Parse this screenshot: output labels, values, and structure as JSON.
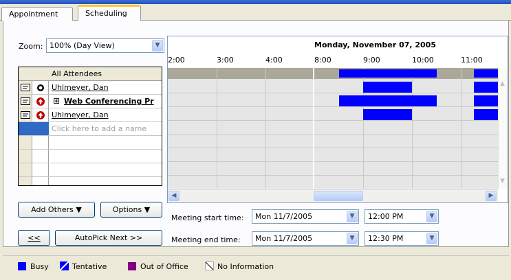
{
  "tabs": [
    {
      "label": "Appointment",
      "active": false
    },
    {
      "label": "Scheduling",
      "active": true
    }
  ],
  "zoom": {
    "label": "Zoom:",
    "value": "100% (Day View)"
  },
  "date_header": "Monday, November 07, 2005",
  "time_ticks": [
    "2:00",
    "3:00",
    "4:00",
    "8:00",
    "9:00",
    "10:00",
    "11:00"
  ],
  "attendees": {
    "header": "All Attendees",
    "rows": [
      {
        "name": "Uhlmeyer, Dan",
        "bold": false,
        "type_icon": "circle-black-icon"
      },
      {
        "name": "Web Conferencing Pr",
        "bold": true,
        "type_icon": "arrow-up-red-icon",
        "expand": "⊞"
      },
      {
        "name": "Uhlmeyer, Dan",
        "bold": false,
        "type_icon": "arrow-up-red-icon"
      }
    ],
    "add_placeholder": "Click here to add a name"
  },
  "buttons": {
    "add_others": "Add Others",
    "options": "Options",
    "prev": "<<",
    "autopick": "AutoPick Next >>"
  },
  "meeting": {
    "start_label": "Meeting start time:",
    "start_date": "Mon 11/7/2005",
    "start_time": "12:00 PM",
    "end_label": "Meeting end time:",
    "end_date": "Mon 11/7/2005",
    "end_time": "12:30 PM"
  },
  "legend": [
    {
      "label": "Busy",
      "color": "#0000ff"
    },
    {
      "label": "Tentative",
      "color": "#0000ff"
    },
    {
      "label": "Out of Office",
      "color": "#800080"
    },
    {
      "label": "No Information",
      "color": "#ffffff"
    }
  ]
}
